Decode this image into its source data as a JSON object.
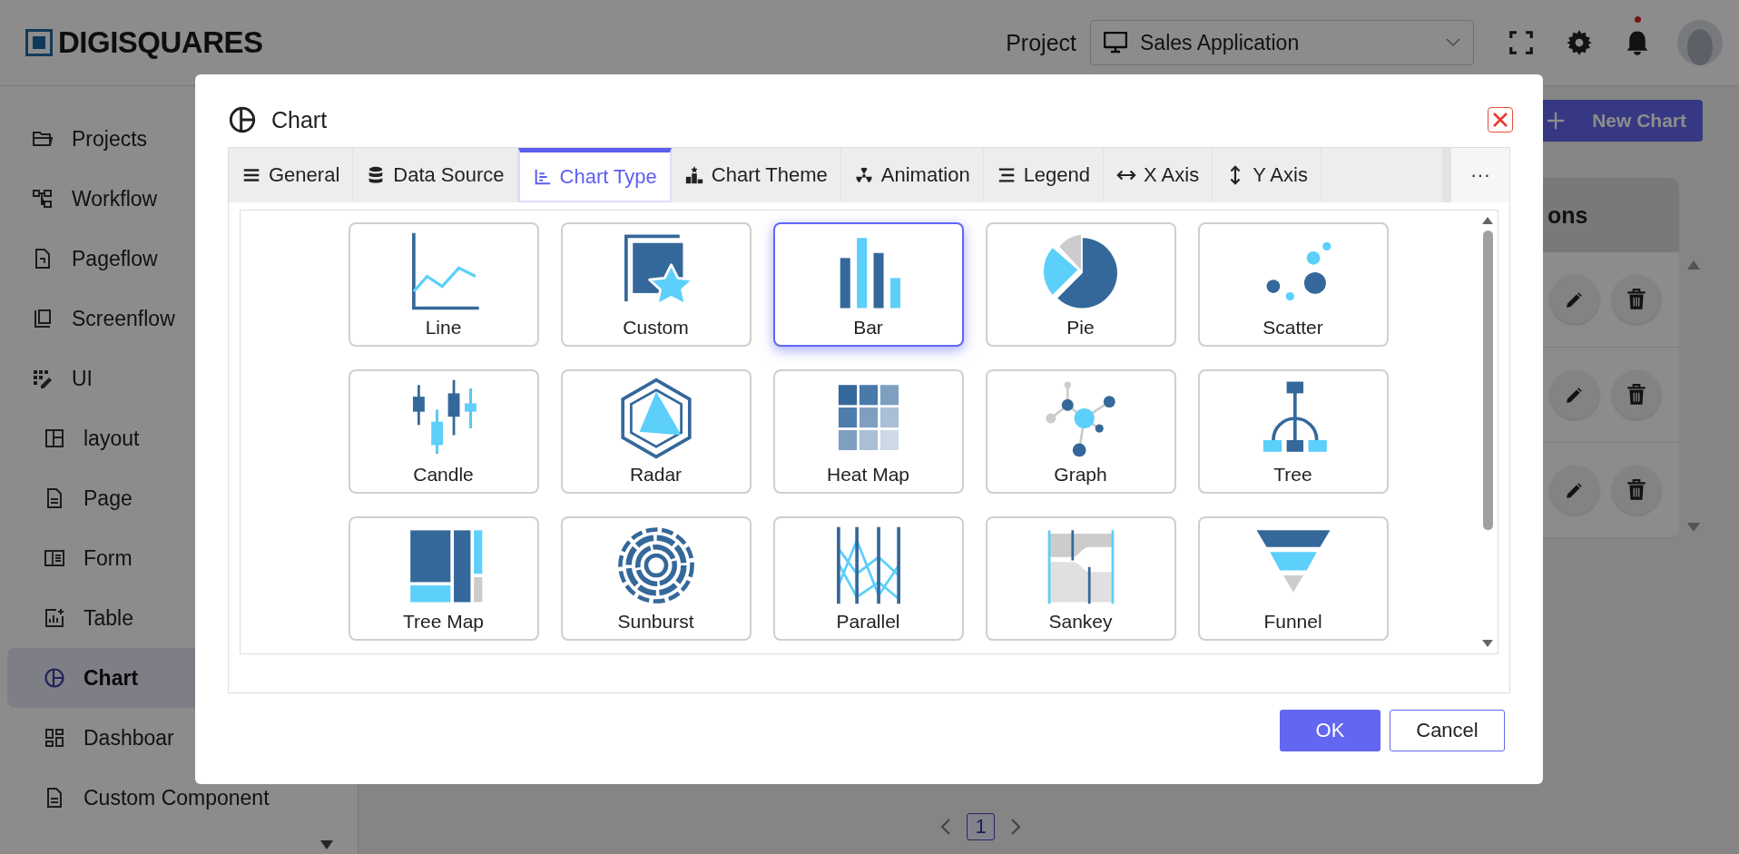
{
  "header": {
    "logo": "DIGISQUARES",
    "project_label": "Project",
    "project_select": {
      "value": "Sales Application"
    }
  },
  "sidebar": {
    "items": [
      {
        "label": "Projects",
        "kind": "folder",
        "selected": false
      },
      {
        "label": "Workflow",
        "kind": "workflow",
        "selected": false
      },
      {
        "label": "Pageflow",
        "kind": "pageflow",
        "selected": false
      },
      {
        "label": "Screenflow",
        "kind": "screenflow",
        "selected": false
      },
      {
        "label": "UI",
        "kind": "ui",
        "selected": false,
        "children": [
          {
            "label": "layout",
            "kind": "layout",
            "selected": false
          },
          {
            "label": "Page",
            "kind": "page",
            "selected": false
          },
          {
            "label": "Form",
            "kind": "form",
            "selected": false
          },
          {
            "label": "Table",
            "kind": "table",
            "selected": false
          },
          {
            "label": "Chart",
            "kind": "chart",
            "selected": true
          },
          {
            "label": "Dashboar",
            "kind": "dashboard",
            "selected": false
          },
          {
            "label": "Custom Component",
            "kind": "page",
            "selected": false
          }
        ]
      }
    ]
  },
  "main": {
    "new_chart_button": "New Chart",
    "table": {
      "column_header": "ons",
      "rows": [
        {
          "actions": [
            {
              "kind": "edit"
            },
            {
              "kind": "delete"
            }
          ]
        },
        {
          "actions": [
            {
              "kind": "edit"
            },
            {
              "kind": "delete"
            }
          ]
        },
        {
          "actions": [
            {
              "kind": "edit"
            },
            {
              "kind": "delete"
            }
          ]
        }
      ]
    },
    "pagination": {
      "pages": [
        {
          "label": "1",
          "selected": true
        }
      ]
    }
  },
  "dialog": {
    "title": "Chart",
    "tabs": [
      {
        "label": "General",
        "kind": "general",
        "selected": false
      },
      {
        "label": "Data Source",
        "kind": "data_source",
        "selected": false
      },
      {
        "label": "Chart Type",
        "kind": "chart_type",
        "selected": true
      },
      {
        "label": "Chart Theme",
        "kind": "chart_theme",
        "selected": false
      },
      {
        "label": "Animation",
        "kind": "animation",
        "selected": false
      },
      {
        "label": "Legend",
        "kind": "legend",
        "selected": false
      },
      {
        "label": "X Axis",
        "kind": "x_axis",
        "selected": false
      },
      {
        "label": "Y Axis",
        "kind": "y_axis",
        "selected": false
      }
    ],
    "more_tabs": "···",
    "chart_types": [
      {
        "label": "Line",
        "kind": "line",
        "selected": false
      },
      {
        "label": "Custom",
        "kind": "custom",
        "selected": false
      },
      {
        "label": "Bar",
        "kind": "bar",
        "selected": true
      },
      {
        "label": "Pie",
        "kind": "pie",
        "selected": false
      },
      {
        "label": "Scatter",
        "kind": "scatter",
        "selected": false
      },
      {
        "label": "Candle",
        "kind": "candle",
        "selected": false
      },
      {
        "label": "Radar",
        "kind": "radar",
        "selected": false
      },
      {
        "label": "Heat Map",
        "kind": "heatmap",
        "selected": false
      },
      {
        "label": "Graph",
        "kind": "graph",
        "selected": false
      },
      {
        "label": "Tree",
        "kind": "tree",
        "selected": false
      },
      {
        "label": "Tree Map",
        "kind": "treemap",
        "selected": false
      },
      {
        "label": "Sunburst",
        "kind": "sunburst",
        "selected": false
      },
      {
        "label": "Parallel",
        "kind": "parallel",
        "selected": false
      },
      {
        "label": "Sankey",
        "kind": "sankey",
        "selected": false
      },
      {
        "label": "Funnel",
        "kind": "funnel",
        "selected": false
      }
    ],
    "buttons": {
      "ok": "OK",
      "cancel": "Cancel"
    }
  }
}
